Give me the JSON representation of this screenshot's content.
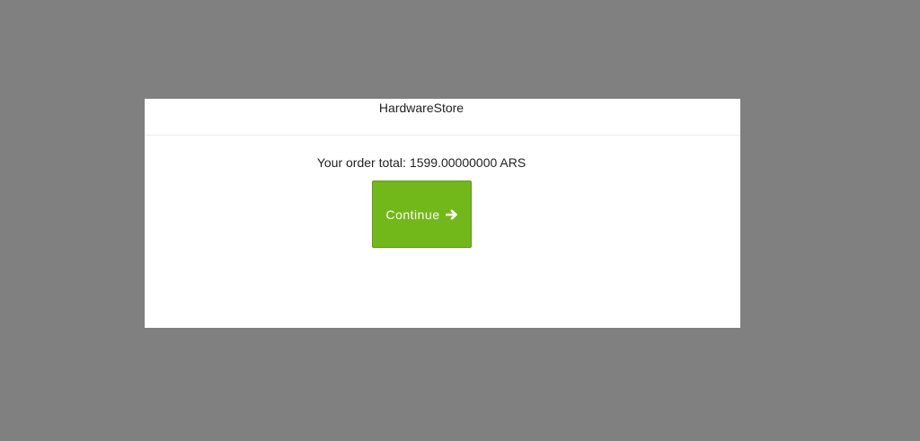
{
  "modal": {
    "store_name": "HardwareStore",
    "order_total_label": "Your order total:",
    "order_total_amount": "1599.00000000 ARS",
    "continue_label": "Continue",
    "continue_icon": "arrow-right-icon"
  },
  "colors": {
    "backdrop": "#808080",
    "modal_background": "#ffffff",
    "button_green": "#72b81a"
  }
}
